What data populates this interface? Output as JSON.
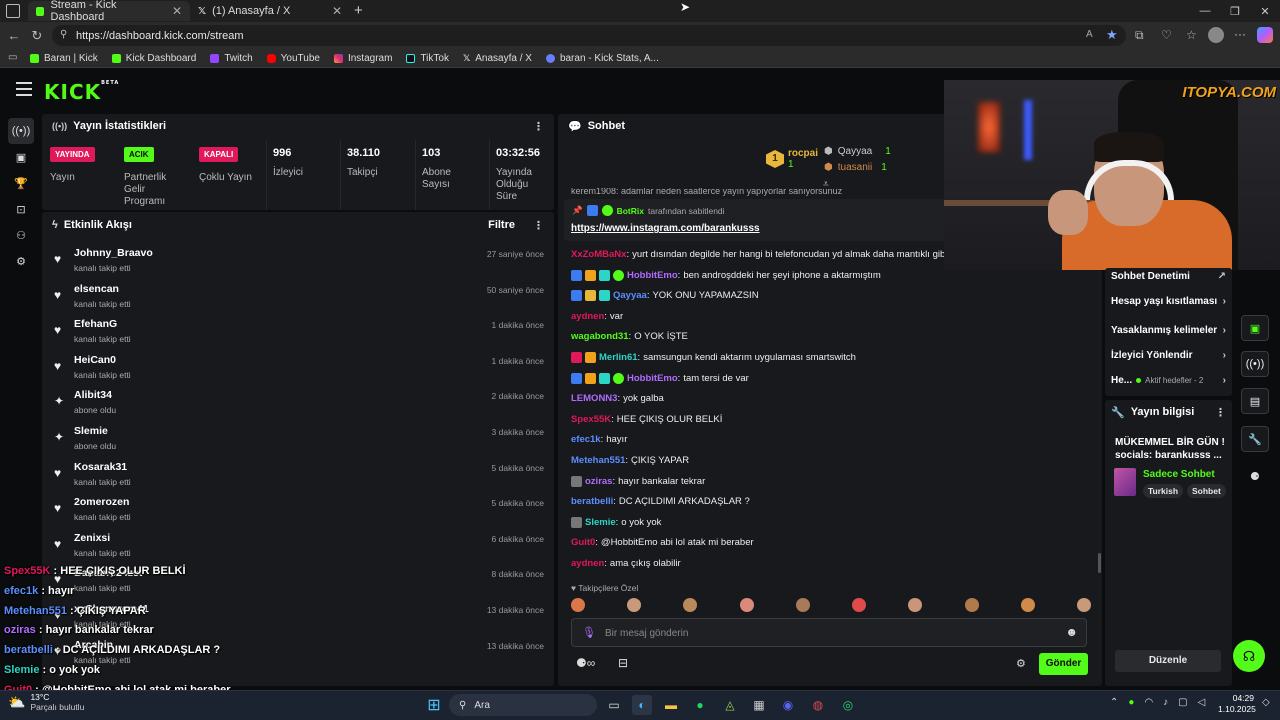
{
  "browser": {
    "tabs": [
      {
        "title": "Stream - Kick Dashboard",
        "active": true
      },
      {
        "title": "(1) Anasayfa / X",
        "active": false
      }
    ],
    "url": "https://dashboard.kick.com/stream",
    "bookmarks": [
      "Baran | Kick",
      "Kick Dashboard",
      "Twitch",
      "YouTube",
      "Instagram",
      "TikTok",
      "Anasayfa / X",
      "baran - Kick Stats, A..."
    ]
  },
  "brand": {
    "logo": "KICK",
    "logo_tag": "BETA",
    "watermark": "ITOPYA.COM",
    "accent": "#53fc18"
  },
  "stats": {
    "title": "Yayın İstatistikleri",
    "badges": [
      {
        "badge": "YAYINDA",
        "label": "Yayın"
      },
      {
        "badge": "ACIK",
        "label": "Partnerlik Gelir Programı"
      },
      {
        "badge": "KAPALI",
        "label": "Çoklu Yayın"
      }
    ],
    "values": [
      {
        "value": "996",
        "label": "İzleyici"
      },
      {
        "value": "38.110",
        "label": "Takipçi"
      },
      {
        "value": "103",
        "label": "Abone Sayısı"
      },
      {
        "value": "03:32:56",
        "label": "Yayında Olduğu Süre"
      }
    ]
  },
  "activity": {
    "title": "Etkinlik Akışı",
    "filter": "Filtre",
    "items": [
      {
        "name": "Johnny_Braavo",
        "action": "kanalı takip etti",
        "time": "27 saniye önce",
        "icon": "heart-icon"
      },
      {
        "name": "elsencan",
        "action": "kanalı takip etti",
        "time": "50 saniye önce",
        "icon": "heart-icon"
      },
      {
        "name": "EfehanG",
        "action": "kanalı takip etti",
        "time": "1 dakika önce",
        "icon": "heart-icon"
      },
      {
        "name": "HeiCan0",
        "action": "kanalı takip etti",
        "time": "1 dakika önce",
        "icon": "heart-icon"
      },
      {
        "name": "Alibit34",
        "action": "abone oldu",
        "time": "2 dakika önce",
        "icon": "sparkle-icon"
      },
      {
        "name": "Slemie",
        "action": "abone oldu",
        "time": "3 dakika önce",
        "icon": "sparkle-icon"
      },
      {
        "name": "Kosarak31",
        "action": "kanalı takip etti",
        "time": "5 dakika önce",
        "icon": "heart-icon"
      },
      {
        "name": "2omerozen",
        "action": "kanalı takip etti",
        "time": "5 dakika önce",
        "icon": "heart-icon"
      },
      {
        "name": "Zenixsi",
        "action": "kanalı takip etti",
        "time": "6 dakika önce",
        "icon": "heart-icon"
      },
      {
        "name": "Bababre24zst",
        "action": "kanalı takip etti",
        "time": "8 dakika önce",
        "icon": "heart-icon"
      },
      {
        "name": "xxShanurem41",
        "action": "kanalı takip etti",
        "time": "13 dakika önce",
        "icon": "heart-icon"
      },
      {
        "name": "Arcabin",
        "action": "kanalı takip etti",
        "time": "13 dakika önce",
        "icon": "heart-icon"
      }
    ]
  },
  "chat": {
    "title": "Sohbet",
    "top_gifters": [
      {
        "rank": "1",
        "name": "rocpai",
        "count": "1"
      },
      {
        "rank": "2",
        "name": "Qayyaa",
        "count": "1"
      },
      {
        "rank": "3",
        "name": "tuasanii",
        "count": "1"
      }
    ],
    "pinned_by": "BotRix",
    "pinned_suffix": "tarafından sabitlendi",
    "pinned_link": "https://www.instagram.com/barankusss",
    "partial_top": "kerem1908: adamlar neden saatlerce yayın yapıyorlar sanıyorsunuz",
    "messages": [
      {
        "user": "XxZoMBaNx",
        "text": "yurt dısından degilde her hangi bi telefoncudan yd almak daha mantıklı gibi",
        "color": "#e0195a"
      },
      {
        "user": "HobbitEmo",
        "text": "ben androşddeki her şeyi iphone a aktarmıştım",
        "color": "#b06cff"
      },
      {
        "user": "Qayyaa",
        "text": "YOK ONU YAPAMAZSIN",
        "color": "#5b8fff"
      },
      {
        "user": "aydnen",
        "text": "var",
        "color": "#e0195a"
      },
      {
        "user": "wagabond31",
        "text": "O YOK İŞTE",
        "color": "#53fc18"
      },
      {
        "user": "Merlin61",
        "text": "samsungun kendi aktarım uygulaması smartswitch",
        "color": "#2bd6c6"
      },
      {
        "user": "HobbitEmo",
        "text": "tam tersi de var",
        "color": "#b06cff"
      },
      {
        "user": "LEMONN3",
        "text": "yok galba",
        "color": "#b06cff"
      },
      {
        "user": "Spex55K",
        "text": "HEE ÇIKIŞ OLUR BELKİ",
        "color": "#e0195a"
      },
      {
        "user": "efec1k",
        "text": "hayır",
        "color": "#5b8fff"
      },
      {
        "user": "Metehan551",
        "text": "ÇIKIŞ YAPAR",
        "color": "#5b8fff"
      },
      {
        "user": "oziras",
        "text": "hayır bankalar tekrar",
        "color": "#b06cff"
      },
      {
        "user": "beratbelli",
        "text": "DC AÇILDIMI ARKADAŞLAR ?",
        "color": "#5b8fff"
      },
      {
        "user": "Slemie",
        "text": "o yok yok",
        "color": "#2bd6c6"
      },
      {
        "user": "Guit0",
        "text": "@HobbitEmo abi lol atak mi beraber",
        "color": "#e0195a"
      },
      {
        "user": "aydnen",
        "text": "ama çıkış olabilir",
        "color": "#e0195a"
      }
    ],
    "followers_only": "Takipçilere Özel",
    "input_placeholder": "Bir mesaj gönderin",
    "send": "Gönder"
  },
  "overlay_chat": [
    {
      "user": "Spex55K",
      "text": "HEE ÇIKIŞ OLUR BELKİ",
      "color": "#e0195a"
    },
    {
      "user": "efec1k",
      "text": "hayır",
      "color": "#5b8fff"
    },
    {
      "user": "Metehan551",
      "text": "ÇIKIŞ YAPAR",
      "color": "#5b8fff"
    },
    {
      "user": "oziras",
      "text": "hayır bankalar tekrar",
      "color": "#b06cff"
    },
    {
      "user": "beratbelli",
      "text": "DC AÇILDIMI ARKADAŞLAR ?",
      "color": "#5b8fff"
    },
    {
      "user": "Slemie",
      "text": "o yok yok",
      "color": "#2bd6c6"
    },
    {
      "user": "Guit0",
      "text": "@HobbitEmo abi lol atak mi beraber",
      "color": "#e0195a"
    }
  ],
  "moderation": {
    "title": "Sohbet Denetimi",
    "items": [
      "Hesap yaşı kısıtlaması",
      "Yasaklanmış kelimeler",
      "İzleyici Yönlendir"
    ],
    "goals_label": "He...",
    "goals_status": "Aktif hedefler - 2"
  },
  "stream_info": {
    "title": "Yayın bilgisi",
    "stream_title": "MÜKEMMEL BİR GÜN ! socials: barankusss ...",
    "category": "Sadece Sohbet",
    "tags": [
      "Turkish",
      "Sohbet"
    ],
    "edit": "Düzenle"
  },
  "taskbar": {
    "weather_temp": "13°C",
    "weather_desc": "Parçalı bulutlu",
    "search": "Ara",
    "time": "04:29",
    "date": "1.10.2025"
  }
}
